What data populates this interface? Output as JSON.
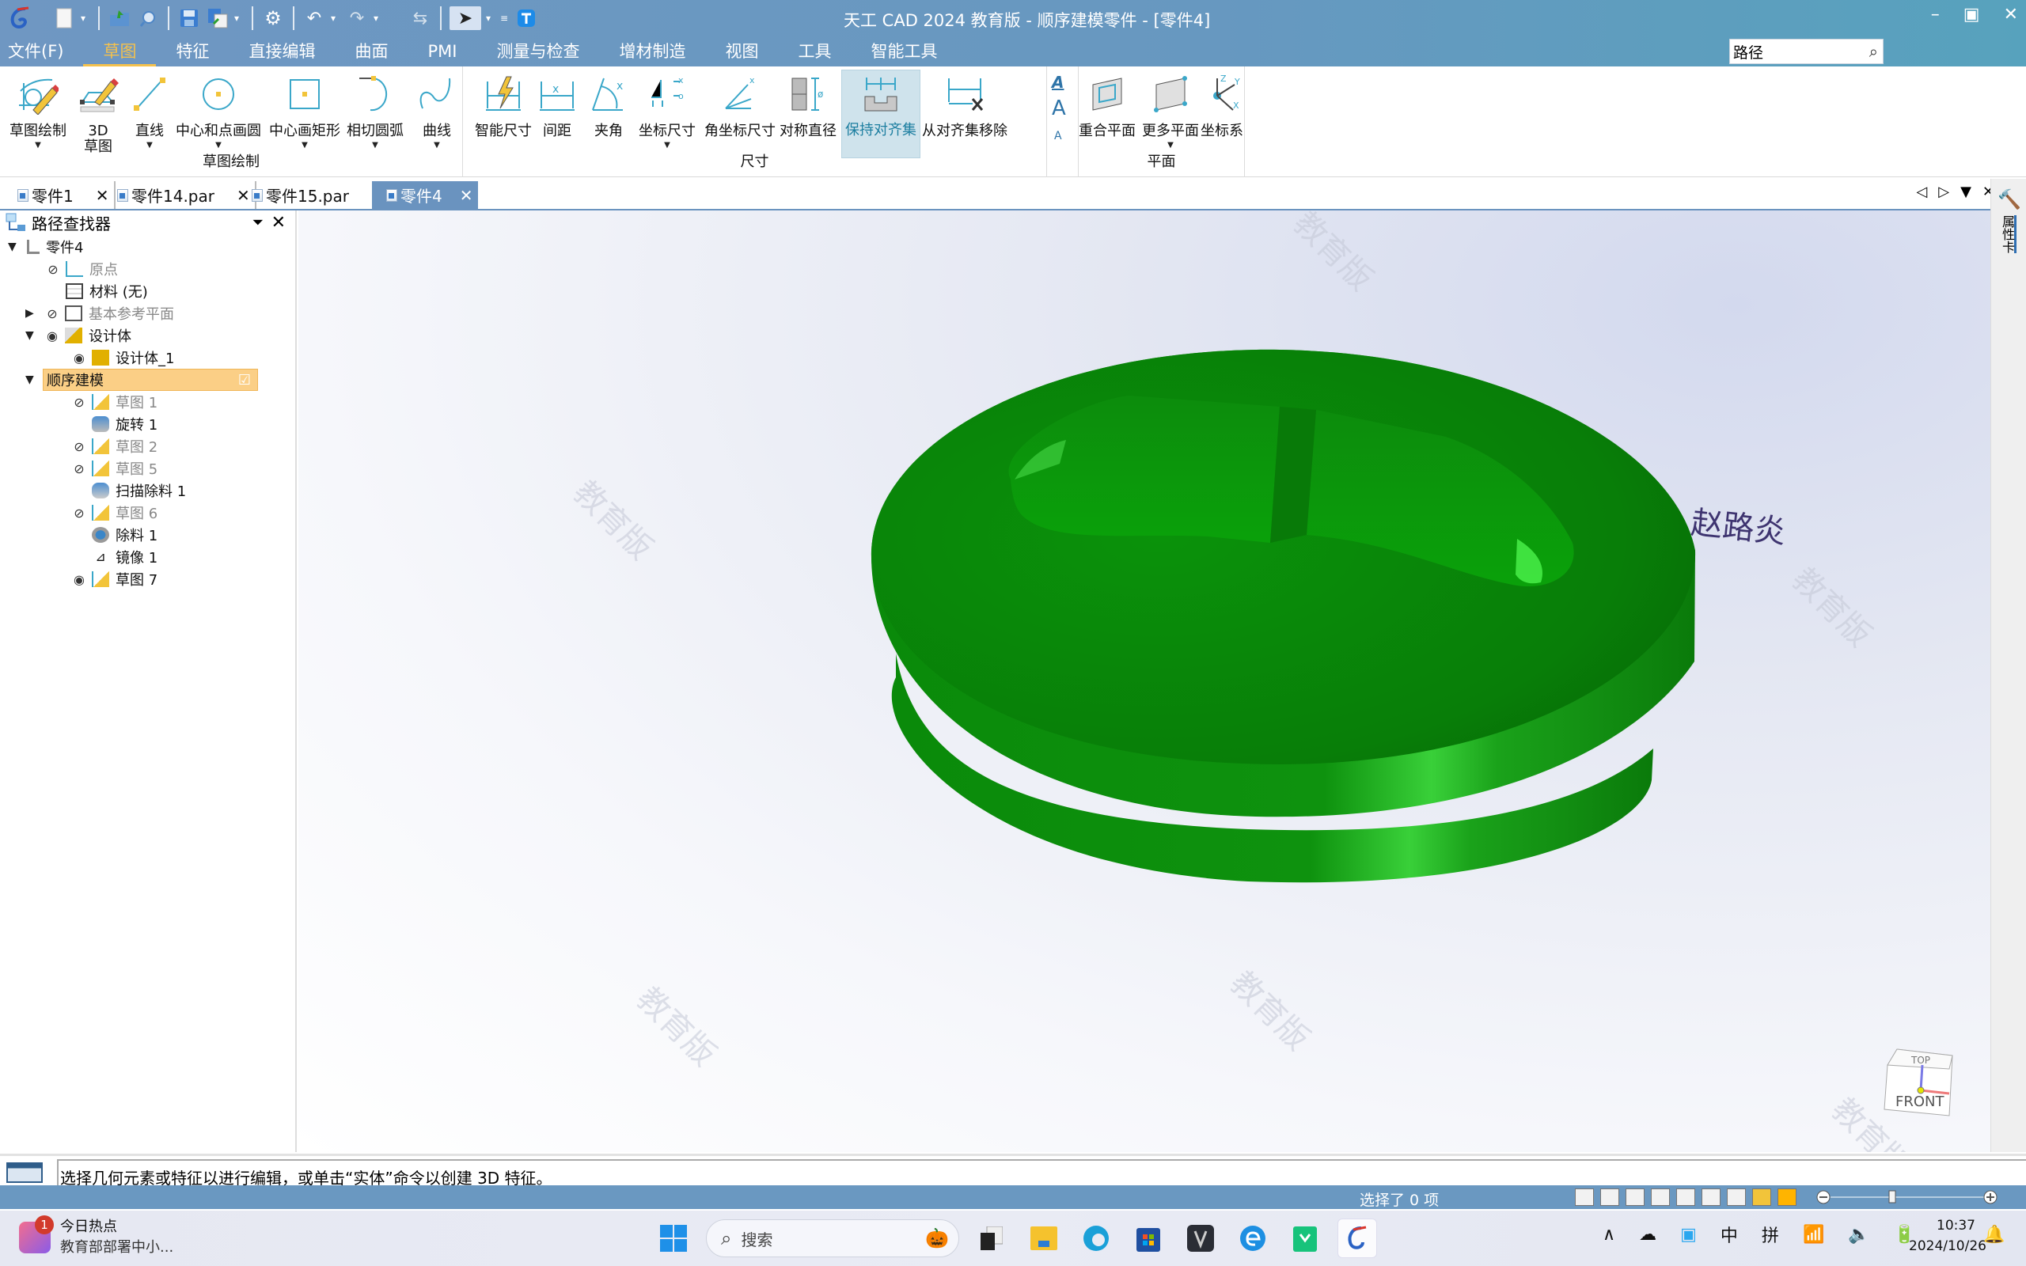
{
  "titlebar": {
    "title": "天工 CAD 2024 教育版 - 顺序建模零件 - [零件4]",
    "qat_icons": [
      "app-logo-icon",
      "new-icon",
      "open-icon",
      "find-icon",
      "save-icon",
      "save-as-icon",
      "settings-icon",
      "undo-icon",
      "redo-icon",
      "repeat-icon",
      "select-icon",
      "customize-icon",
      "text-t-icon"
    ],
    "controls": {
      "minimize": "–",
      "restore": "▣",
      "close": "✕"
    }
  },
  "menubar": {
    "items": [
      {
        "label": "文件(F)",
        "active": false
      },
      {
        "label": "草图",
        "active": true
      },
      {
        "label": "特征",
        "active": false
      },
      {
        "label": "直接编辑",
        "active": false
      },
      {
        "label": "曲面",
        "active": false
      },
      {
        "label": "PMI",
        "active": false
      },
      {
        "label": "测量与检查",
        "active": false
      },
      {
        "label": "增材制造",
        "active": false
      },
      {
        "label": "视图",
        "active": false
      },
      {
        "label": "工具",
        "active": false
      },
      {
        "label": "智能工具",
        "active": false
      }
    ],
    "search_value": "路径",
    "right_controls": [
      "?",
      "_",
      "▣",
      "✕"
    ]
  },
  "ribbon": {
    "groups": [
      {
        "label": "草图绘制",
        "buttons": [
          "草图绘制",
          "3D\n草图",
          "直线",
          "中心和点画圆",
          "中心画矩形",
          "相切圆弧",
          "曲线"
        ]
      },
      {
        "label": "尺寸",
        "buttons": [
          "智能尺寸",
          "间距",
          "夹角",
          "坐标尺寸",
          "角坐标尺寸",
          "对称直径",
          "保持对齐集",
          "从对齐集移除"
        ]
      },
      {
        "label": "平面",
        "buttons": [
          "重合平面",
          "更多平面",
          "坐标系"
        ]
      }
    ],
    "highlighted": "保持对齐集",
    "b": {
      "sketch": "草图绘制",
      "sketch3d_1": "3D",
      "sketch3d_2": "草图",
      "line": "直线",
      "circle": "中心和点画圆",
      "rect": "中心画矩形",
      "arc": "相切圆弧",
      "curve": "曲线",
      "smartdim": "智能尺寸",
      "distance": "间距",
      "angle": "夹角",
      "coord": "坐标尺寸",
      "angcoord": "角坐标尺寸",
      "symdia": "对称直径",
      "keepalign": "保持对齐集",
      "removealign": "从对齐集移除",
      "coplane": "重合平面",
      "moreplane": "更多平面",
      "csys": "坐标系"
    },
    "g": {
      "sketch": "草图绘制",
      "dim": "尺寸",
      "plane": "平面"
    }
  },
  "doc_tabs": [
    {
      "label": "零件1",
      "active": false
    },
    {
      "label": "零件14.par",
      "active": false
    },
    {
      "label": "零件15.par",
      "active": false
    },
    {
      "label": "零件4",
      "active": true
    }
  ],
  "pathfinder": {
    "title": "路径查找器",
    "root": "零件4",
    "items": [
      {
        "label": "原点",
        "dim": true,
        "eye": "hidden"
      },
      {
        "label": "材料 (无)",
        "dim": false,
        "eye": ""
      },
      {
        "label": "基本参考平面",
        "dim": true,
        "eye": "hidden"
      },
      {
        "label": "设计体",
        "dim": false,
        "eye": "visible"
      },
      {
        "label": "设计体_1",
        "dim": false,
        "eye": "visible"
      },
      {
        "label": "顺序建模",
        "dim": false,
        "eye": "",
        "selected": true
      },
      {
        "label": "草图 1",
        "dim": true,
        "eye": "hidden"
      },
      {
        "label": "旋转 1",
        "dim": false,
        "eye": ""
      },
      {
        "label": "草图 2",
        "dim": true,
        "eye": "hidden"
      },
      {
        "label": "草图 5",
        "dim": true,
        "eye": "hidden"
      },
      {
        "label": "扫描除料 1",
        "dim": false,
        "eye": ""
      },
      {
        "label": "草图 6",
        "dim": true,
        "eye": "hidden"
      },
      {
        "label": "除料 1",
        "dim": false,
        "eye": ""
      },
      {
        "label": "镜像 1",
        "dim": false,
        "eye": ""
      },
      {
        "label": "草图 7",
        "dim": false,
        "eye": "visible"
      }
    ]
  },
  "viewport": {
    "watermark": "教育版",
    "author_text": "赵路炎",
    "model_color": "#0a8a0a",
    "viewcube": {
      "top": "TOP",
      "front": "FRONT"
    }
  },
  "right_panel": {
    "label": "属性卡"
  },
  "status": {
    "message": "选择几何元素或特征以进行编辑，或单击“实体”命令以创建 3D 特征。",
    "selection": "选择了 0 项"
  },
  "taskbar": {
    "news_badge": "1",
    "news_title": "今日热点",
    "news_sub": "教育部部署中小...",
    "search_placeholder": "搜索",
    "tray": {
      "ime1": "中",
      "ime2": "拼",
      "chevron": "∧"
    },
    "time": "10:37",
    "date": "2024/10/26"
  }
}
